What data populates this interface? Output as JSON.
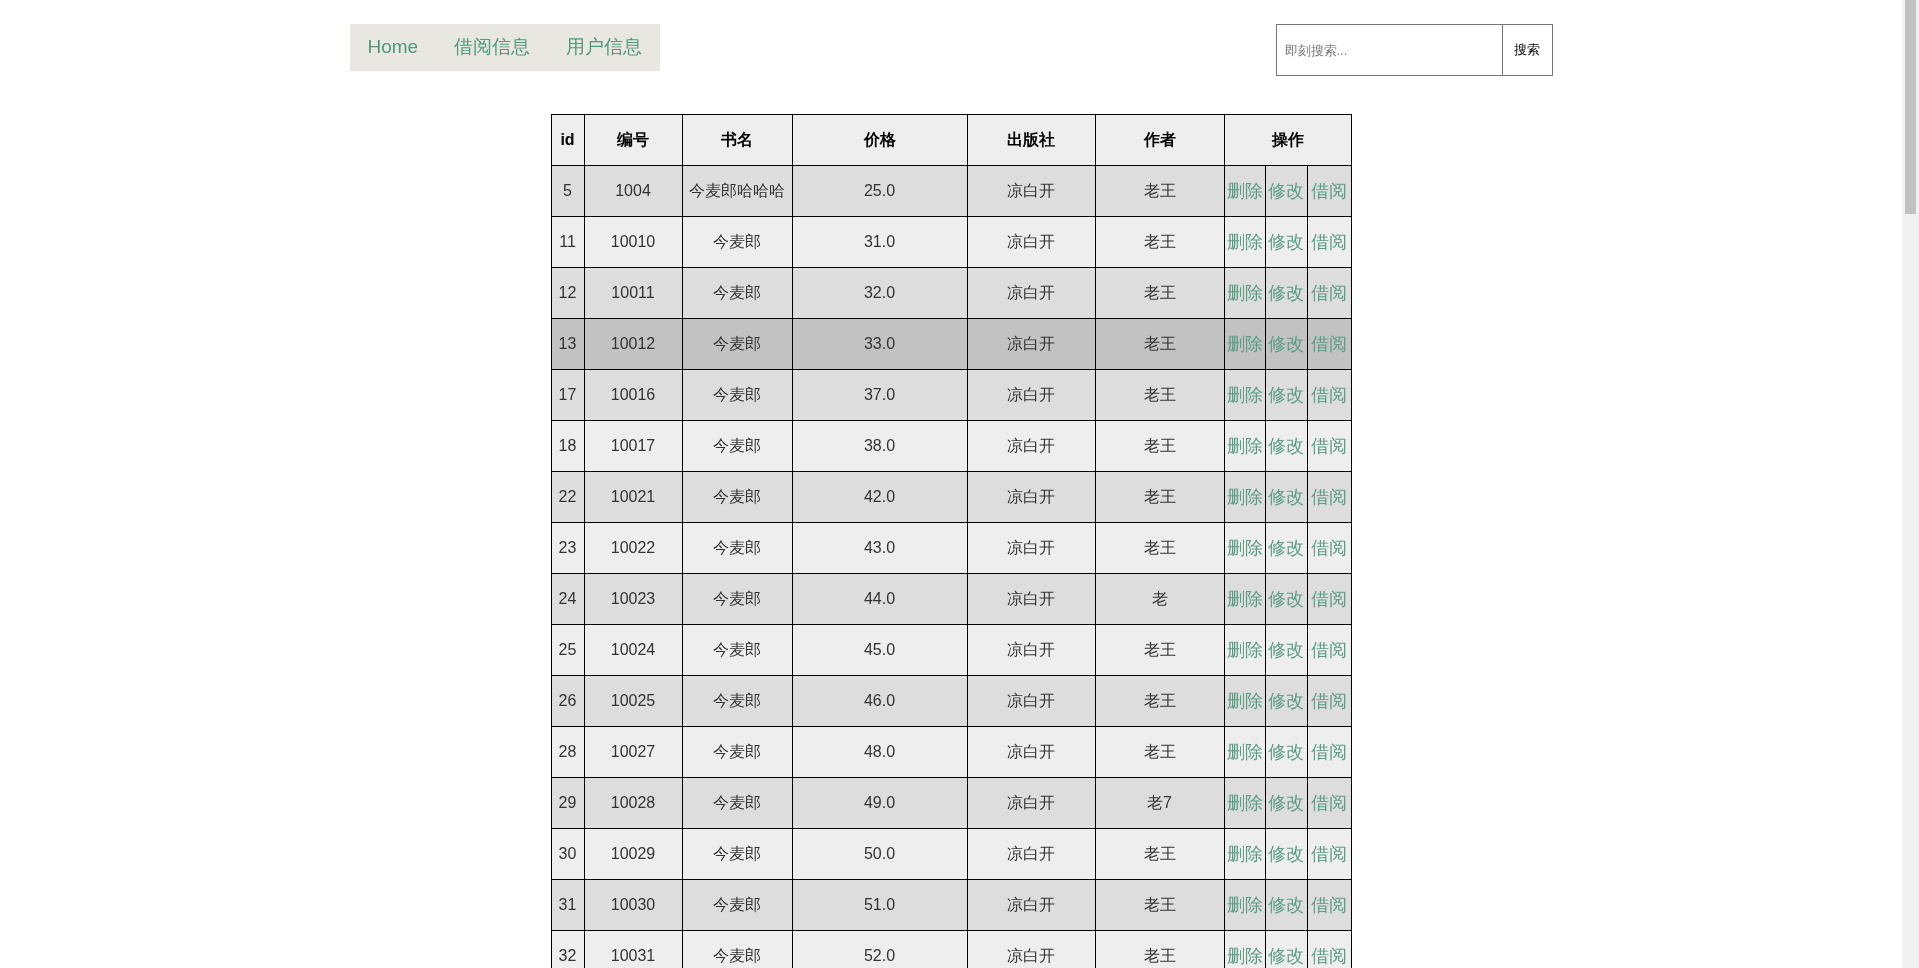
{
  "nav": {
    "items": [
      {
        "label": "Home"
      },
      {
        "label": "借阅信息"
      },
      {
        "label": "用户信息"
      }
    ]
  },
  "search": {
    "placeholder": "即刻搜索...",
    "button": "搜索"
  },
  "table": {
    "columns": [
      "id",
      "编号",
      "书名",
      "价格",
      "出版社",
      "作者",
      "操作"
    ],
    "rows": [
      {
        "cells": [
          "5",
          "1004",
          "今麦郎哈哈哈",
          "25.0",
          "凉白开",
          "老王"
        ],
        "actions": [
          "删除",
          "修改",
          "借阅"
        ],
        "hovered": false
      },
      {
        "cells": [
          "11",
          "10010",
          "今麦郎",
          "31.0",
          "凉白开",
          "老王"
        ],
        "actions": [
          "删除",
          "修改",
          "借阅"
        ],
        "hovered": false
      },
      {
        "cells": [
          "12",
          "10011",
          "今麦郎",
          "32.0",
          "凉白开",
          "老王"
        ],
        "actions": [
          "删除",
          "修改",
          "借阅"
        ],
        "hovered": false
      },
      {
        "cells": [
          "13",
          "10012",
          "今麦郎",
          "33.0",
          "凉白开",
          "老王"
        ],
        "actions": [
          "删除",
          "修改",
          "借阅"
        ],
        "hovered": true
      },
      {
        "cells": [
          "17",
          "10016",
          "今麦郎",
          "37.0",
          "凉白开",
          "老王"
        ],
        "actions": [
          "删除",
          "修改",
          "借阅"
        ],
        "hovered": false
      },
      {
        "cells": [
          "18",
          "10017",
          "今麦郎",
          "38.0",
          "凉白开",
          "老王"
        ],
        "actions": [
          "删除",
          "修改",
          "借阅"
        ],
        "hovered": false
      },
      {
        "cells": [
          "22",
          "10021",
          "今麦郎",
          "42.0",
          "凉白开",
          "老王"
        ],
        "actions": [
          "删除",
          "修改",
          "借阅"
        ],
        "hovered": false
      },
      {
        "cells": [
          "23",
          "10022",
          "今麦郎",
          "43.0",
          "凉白开",
          "老王"
        ],
        "actions": [
          "删除",
          "修改",
          "借阅"
        ],
        "hovered": false
      },
      {
        "cells": [
          "24",
          "10023",
          "今麦郎",
          "44.0",
          "凉白开",
          "老"
        ],
        "actions": [
          "删除",
          "修改",
          "借阅"
        ],
        "hovered": false
      },
      {
        "cells": [
          "25",
          "10024",
          "今麦郎",
          "45.0",
          "凉白开",
          "老王"
        ],
        "actions": [
          "删除",
          "修改",
          "借阅"
        ],
        "hovered": false
      },
      {
        "cells": [
          "26",
          "10025",
          "今麦郎",
          "46.0",
          "凉白开",
          "老王"
        ],
        "actions": [
          "删除",
          "修改",
          "借阅"
        ],
        "hovered": false
      },
      {
        "cells": [
          "28",
          "10027",
          "今麦郎",
          "48.0",
          "凉白开",
          "老王"
        ],
        "actions": [
          "删除",
          "修改",
          "借阅"
        ],
        "hovered": false
      },
      {
        "cells": [
          "29",
          "10028",
          "今麦郎",
          "49.0",
          "凉白开",
          "老7"
        ],
        "actions": [
          "删除",
          "修改",
          "借阅"
        ],
        "hovered": false
      },
      {
        "cells": [
          "30",
          "10029",
          "今麦郎",
          "50.0",
          "凉白开",
          "老王"
        ],
        "actions": [
          "删除",
          "修改",
          "借阅"
        ],
        "hovered": false
      },
      {
        "cells": [
          "31",
          "10030",
          "今麦郎",
          "51.0",
          "凉白开",
          "老王"
        ],
        "actions": [
          "删除",
          "修改",
          "借阅"
        ],
        "hovered": false
      },
      {
        "cells": [
          "32",
          "10031",
          "今麦郎",
          "52.0",
          "凉白开",
          "老王"
        ],
        "actions": [
          "删除",
          "修改",
          "借阅"
        ],
        "hovered": false
      }
    ]
  }
}
